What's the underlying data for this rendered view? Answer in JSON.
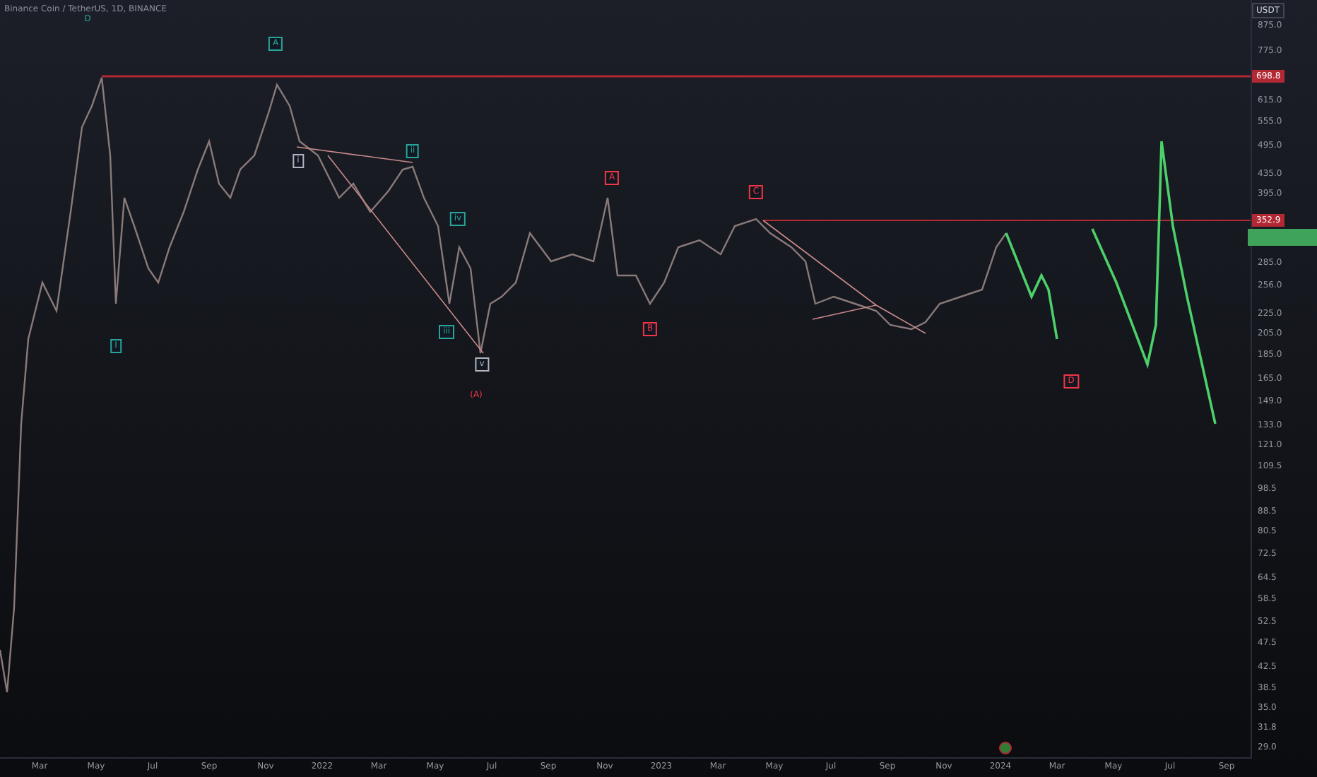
{
  "chart": {
    "title": "Binance Coin / TetherUS, 1D, BINANCE",
    "wave_labels": [
      {
        "text": "D",
        "color": "#26a69a",
        "boxed": false
      },
      {
        "text": "A",
        "color": "#26a69a",
        "boxed": true
      },
      {
        "text": "I",
        "color": "#26a69a",
        "boxed": true
      },
      {
        "text": "i",
        "color": "#b2b5be",
        "boxed": true
      },
      {
        "text": "ii",
        "color": "#26a69a",
        "boxed": true
      },
      {
        "text": "iv",
        "color": "#26a69a",
        "boxed": true
      },
      {
        "text": "iii",
        "color": "#26a69a",
        "boxed": true
      },
      {
        "text": "v",
        "color": "#b2b5be",
        "boxed": true
      },
      {
        "text": "(A)",
        "color": "#f23645",
        "boxed": false
      },
      {
        "text": "A",
        "color": "#f23645",
        "boxed": true
      },
      {
        "text": "B",
        "color": "#f23645",
        "boxed": true
      },
      {
        "text": "C",
        "color": "#f23645",
        "boxed": true
      },
      {
        "text": "D",
        "color": "#f23645",
        "boxed": true
      }
    ]
  },
  "price_axis": {
    "currency": "USDT",
    "ticks": [
      "875.0",
      "775.0",
      "615.0",
      "555.0",
      "495.0",
      "435.0",
      "395.0",
      "285.0",
      "256.0",
      "225.0",
      "205.0",
      "185.0",
      "165.0",
      "149.0",
      "133.0",
      "121.0",
      "109.5",
      "98.5",
      "88.5",
      "80.5",
      "72.5",
      "64.5",
      "58.5",
      "52.5",
      "47.5",
      "42.5",
      "38.5",
      "35.0",
      "31.8",
      "29.0"
    ],
    "price_tags": [
      {
        "text": "698.8",
        "color": "#b22833"
      },
      {
        "text": "352.9",
        "color": "#b22833"
      }
    ]
  },
  "time_axis": {
    "labels": [
      "Mar",
      "May",
      "Jul",
      "Sep",
      "Nov",
      "2022",
      "Mar",
      "May",
      "Jul",
      "Sep",
      "Nov",
      "2023",
      "Mar",
      "May",
      "Jul",
      "Sep",
      "Nov",
      "2024",
      "Mar",
      "May",
      "Jul",
      "Sep"
    ]
  }
}
